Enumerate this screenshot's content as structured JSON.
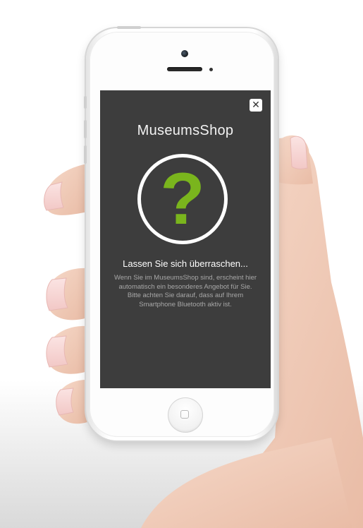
{
  "screen": {
    "close_symbol": "✕",
    "app_title": "MuseumsShop",
    "icon": "question-mark-icon",
    "question_glyph": "?",
    "headline": "Lassen Sie sich überraschen...",
    "body": "Wenn Sie im MuseumsShop sind, erscheint hier automatisch ein besonderes Angebot für Sie. Bitte achten Sie darauf, dass auf Ihrem Smartphone Bluetooth aktiv ist."
  },
  "colors": {
    "screen_background": "#3d3d3d",
    "accent_green": "#7ab51d",
    "text_primary": "#ffffff",
    "text_secondary": "#a8a8a8"
  }
}
